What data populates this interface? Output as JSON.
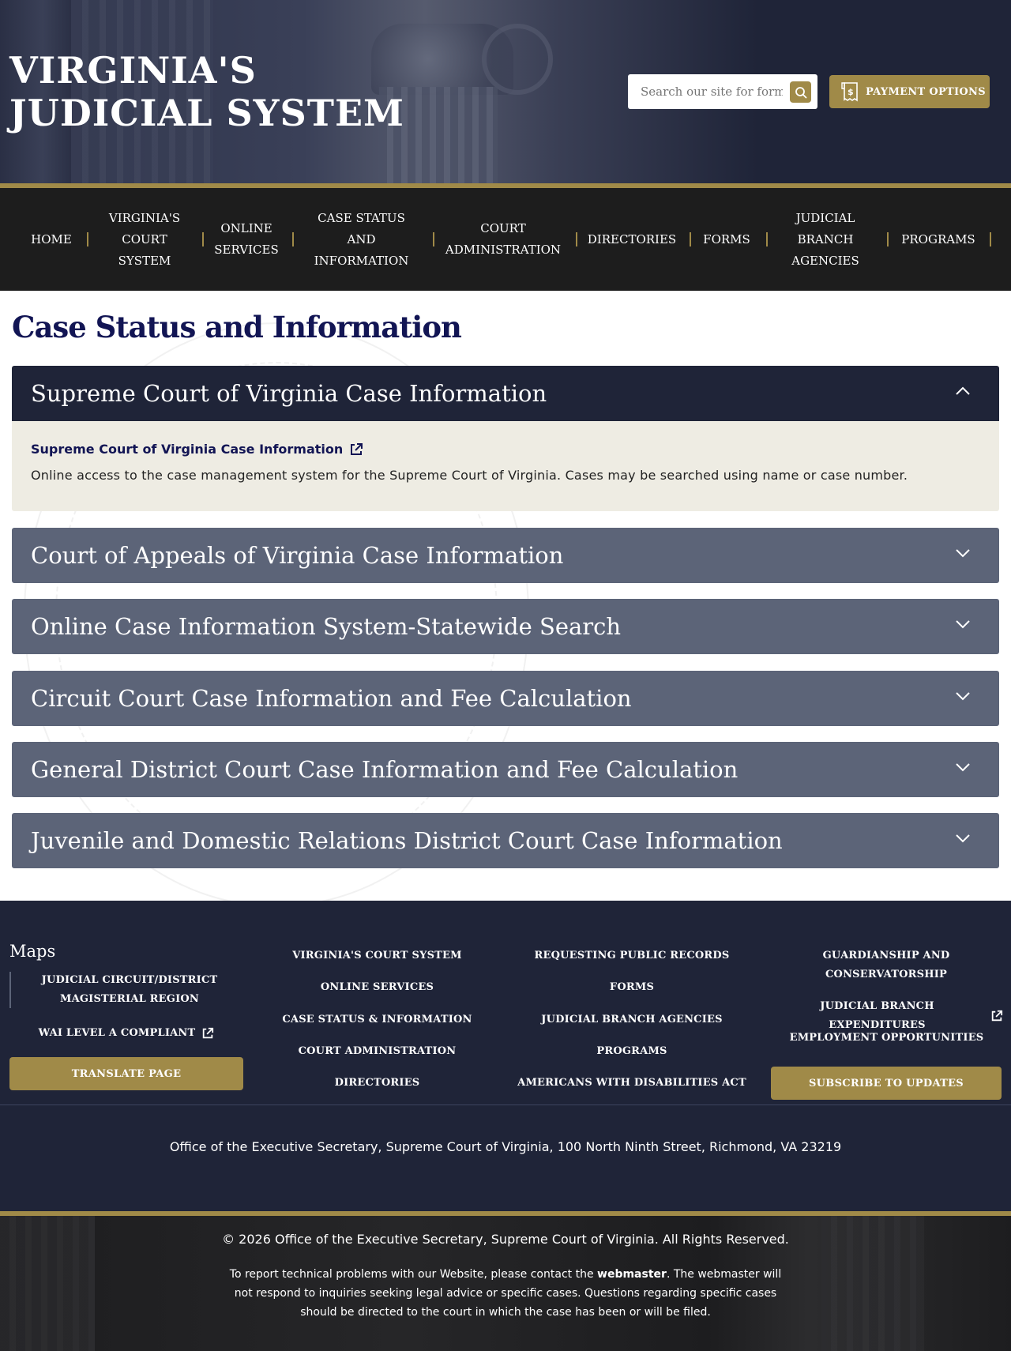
{
  "header": {
    "title": "VIRGINIA'S JUDICIAL SYSTEM",
    "search_placeholder": "Search our site for forms,",
    "payment_label": "PAYMENT OPTIONS"
  },
  "nav": {
    "items": [
      {
        "label": "HOME"
      },
      {
        "label": "VIRGINIA'S COURT SYSTEM"
      },
      {
        "label": "ONLINE SERVICES"
      },
      {
        "label": "CASE STATUS AND INFORMATION"
      },
      {
        "label": "COURT ADMINISTRATION"
      },
      {
        "label": "DIRECTORIES"
      },
      {
        "label": "FORMS"
      },
      {
        "label": "JUDICIAL BRANCH AGENCIES"
      },
      {
        "label": "PROGRAMS"
      }
    ]
  },
  "main": {
    "title": "Case Status and Information",
    "accordions": [
      {
        "title": "Supreme Court of Virginia Case Information",
        "expanded": true,
        "link": "Supreme Court of Virginia Case Information",
        "description": "Online access to the case management system for the Supreme Court of Virginia. Cases may be searched using name or case number."
      },
      {
        "title": "Court of Appeals of Virginia Case Information",
        "expanded": false
      },
      {
        "title": "Online Case Information System-Statewide Search",
        "expanded": false
      },
      {
        "title": "Circuit Court Case Information and Fee Calculation",
        "expanded": false
      },
      {
        "title": "General District Court Case Information and Fee Calculation",
        "expanded": false
      },
      {
        "title": "Juvenile and Domestic Relations District Court Case Information",
        "expanded": false
      }
    ]
  },
  "footer": {
    "maps_heading": "Maps",
    "maps_link": "JUDICIAL CIRCUIT/DISTRICT MAGISTERIAL REGION",
    "wai_link": "WAI LEVEL A COMPLIANT",
    "translate_label": "TRANSLATE PAGE",
    "col2": [
      "VIRGINIA'S COURT SYSTEM",
      "ONLINE SERVICES",
      "CASE STATUS & INFORMATION",
      "COURT ADMINISTRATION",
      "DIRECTORIES"
    ],
    "col3": [
      "REQUESTING PUBLIC RECORDS",
      "FORMS",
      "JUDICIAL BRANCH AGENCIES",
      "PROGRAMS",
      "AMERICANS WITH DISABILITIES ACT"
    ],
    "col4": [
      "GUARDIANSHIP AND CONSERVATORSHIP",
      "JUDICIAL BRANCH EXPENDITURES",
      "EMPLOYMENT OPPORTUNITIES"
    ],
    "subscribe_label": "SUBSCRIBE TO UPDATES",
    "address": "Office of the Executive Secretary, Supreme Court of Virginia, 100 North Ninth Street, Richmond, VA 23219"
  },
  "bottom": {
    "copyright": "© 2026 Office of the Executive Secretary, Supreme Court of Virginia. All Rights Reserved.",
    "report_pre": "To report technical problems with our Website, please contact the ",
    "report_link": "webmaster",
    "report_post": ". The webmaster will not respond to inquiries seeking legal advice or specific cases. Questions regarding specific cases should be directed to the court in which the case has been or will be filed."
  },
  "colors": {
    "navy": "#1f2438",
    "gold": "#a08a48",
    "accordion_closed": "#5c6478",
    "accordion_body": "#eeece3",
    "title_blue": "#121554"
  },
  "icons": {
    "search": "search-icon",
    "payment": "receipt-dollar-icon",
    "chevron_up": "chevron-up-icon",
    "chevron_down": "chevron-down-icon",
    "external": "external-link-icon"
  }
}
